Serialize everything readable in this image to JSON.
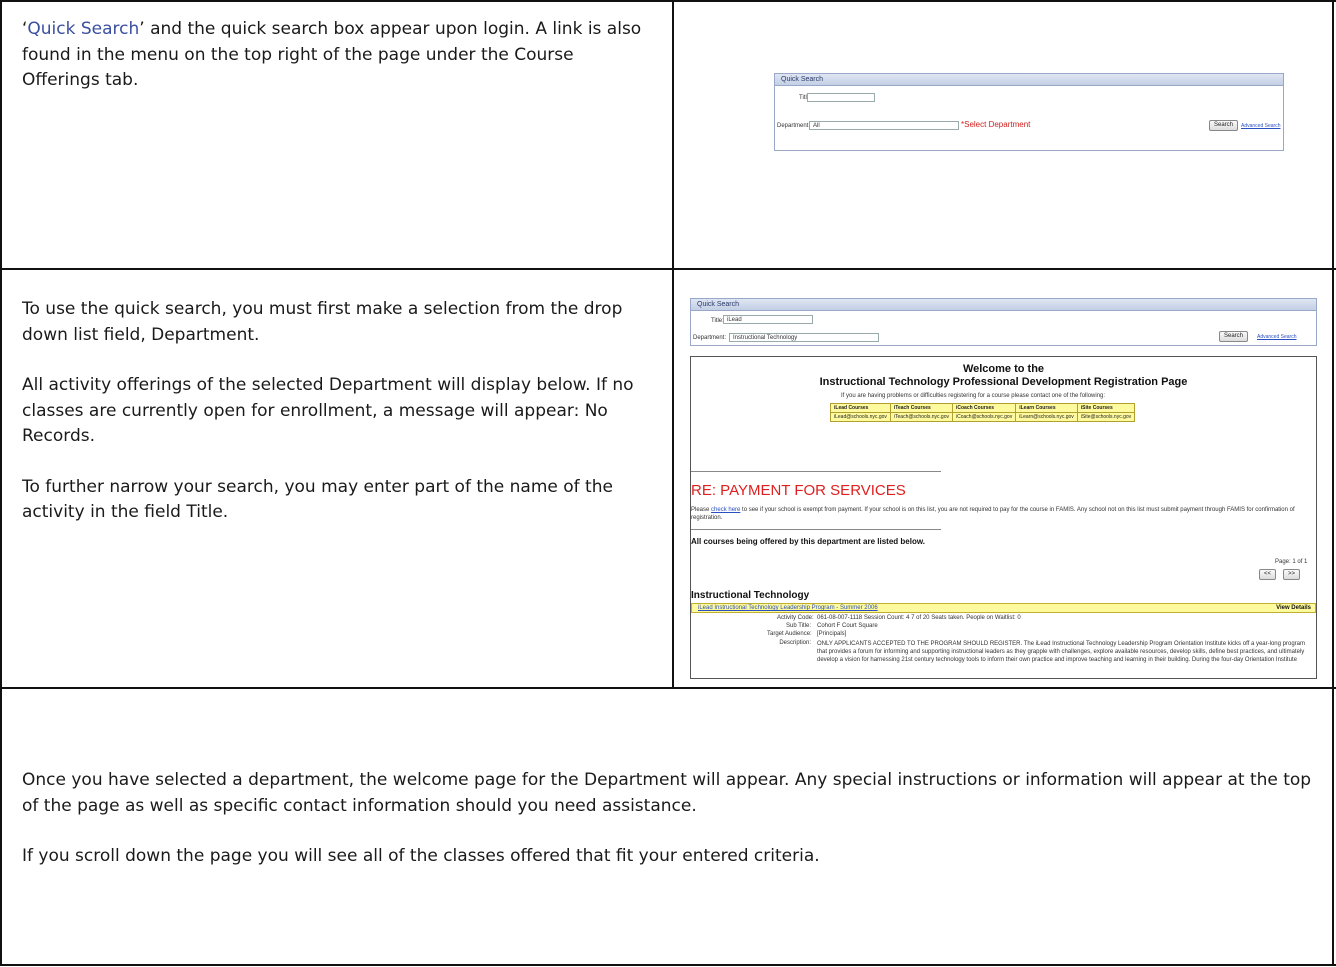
{
  "row1": {
    "quote_open": "‘",
    "quick_search_link": "Quick Search",
    "text_rest": "’ and the quick search box appear upon login. A link is also found in the menu on the top right of the page under the Course Offerings tab."
  },
  "row2": {
    "para1": "To use the quick search, you must first make a selection from the drop down list field, Department.",
    "para2": "All activity offerings of the selected Department will display below. If no classes are currently open for enrollment, a message will appear: No Records.",
    "para3": "To further narrow your search, you may enter part of the name of the activity in the field Title."
  },
  "row3": {
    "para1": "Once you have selected a department, the welcome page for the Department will appear. Any special instructions or information will appear at the top of the page as well as specific contact information should you need assistance.",
    "para2": "If you scroll down the page you will see all of the classes offered that fit your entered criteria."
  },
  "shot1": {
    "header": "Quick Search",
    "title_label": "Title:",
    "title_value": "",
    "department_label": "Department:",
    "department_value": "All",
    "select_hint": "*Select Department",
    "search_button": "Search",
    "advanced_link": "Advanced Search"
  },
  "shot2": {
    "header": "Quick Search",
    "title_label": "Title:",
    "title_value": "iLead",
    "department_label": "Department:",
    "department_value": "Instructional Technology",
    "search_button": "Search",
    "advanced_link": "Advanced Search",
    "welcome_line1": "Welcome to the",
    "welcome_line2": "Instructional Technology Professional Development Registration Page",
    "contact_intro": "If you are having problems or difficulties registering for a course please contact one of the following:",
    "contacts": {
      "headers": [
        "iLead Courses",
        "iTeach Courses",
        "iCoach Courses",
        "iLearn Courses",
        "iSite Courses"
      ],
      "emails": [
        "iLead@schools.nyc.gov",
        "iTeach@schools.nyc.gov",
        "iCoach@schools.nyc.gov",
        "iLearn@schools.nyc.gov",
        "iSite@schools.nyc.gov"
      ]
    },
    "payment_heading": "RE: PAYMENT FOR SERVICES",
    "payment_text_pre": "Please ",
    "payment_link": "check here",
    "payment_text_post": " to see if your school is exempt from payment. If your school is on this list, you are not required to pay for the course in FAMIS. Any school not on this list must submit payment through FAMIS for confirmation of registration.",
    "all_courses": "All courses being offered by this department are listed below.",
    "page_info": "Page: 1 of 1",
    "prev_button": "<<",
    "next_button": ">>",
    "section_title": "Instructional Technology",
    "course_name": "iLead Instructional Technology Leadership Program - Summer 2006",
    "view_details": "View Details",
    "activity_code_label": "Activity Code:",
    "activity_code_value": "061-08-007-1118  Session Count: 4  7 of 20 Seats taken.  People on Waitlist: 0",
    "subtitle_label": "Sub Title:",
    "subtitle_value": "Cohort F Court Square",
    "audience_label": "Target Audience:",
    "audience_value": "[Principals]",
    "description_label": "Description:",
    "description_value": "ONLY APPLICANTS ACCEPTED TO THE PROGRAM SHOULD REGISTER. The iLead Instructional Technology Leadership Program Orientation Institute kicks off a year-long program that provides a forum for informing and supporting instructional leaders as they grapple with challenges, explore available resources, develop skills, define best practices, and ultimately develop a vision for harnessing 21st century technology tools to inform their own practice and improve teaching and learning in their building. During the four-day Orientation Institute"
  }
}
